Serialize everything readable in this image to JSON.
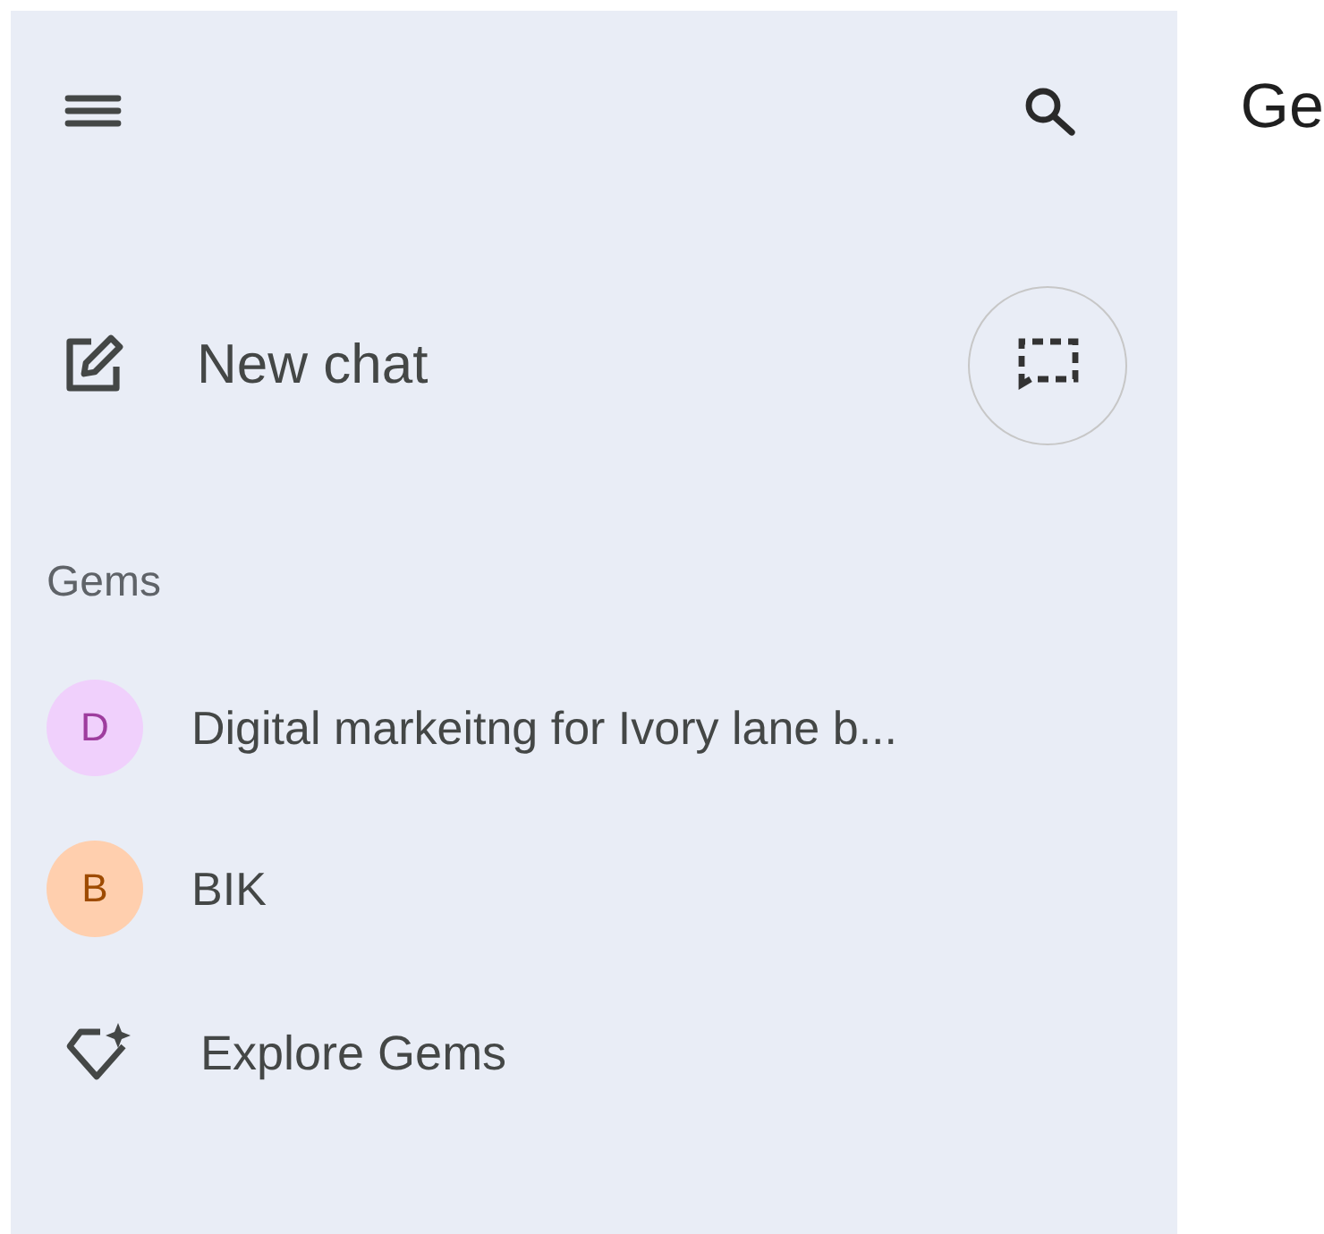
{
  "sidebar": {
    "new_chat": {
      "label": "New chat"
    },
    "gems_heading": "Gems",
    "gems": [
      {
        "letter": "D",
        "name": "Digital markeitng for Ivory lane b...",
        "color": "#f0d0fc"
      },
      {
        "letter": "B",
        "name": "BIK",
        "color": "#ffcfae"
      }
    ],
    "explore": {
      "label": "Explore Gems"
    }
  },
  "main": {
    "title": "Ge"
  }
}
